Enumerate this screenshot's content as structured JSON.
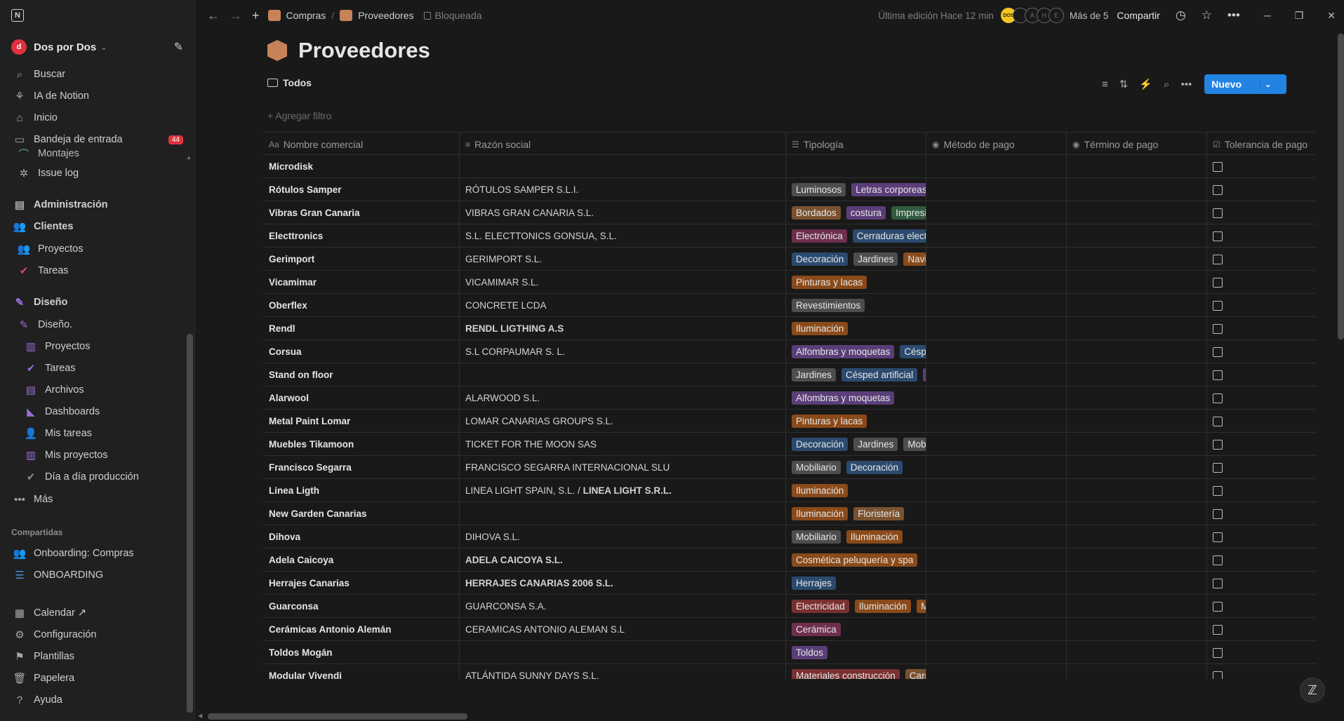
{
  "workspace": {
    "name": "Dos por Dos",
    "avatar_letter": "d"
  },
  "sidebar": {
    "top_items": [
      {
        "name": "sidebar-item-buscar",
        "label": "Buscar",
        "icon": "search-icon",
        "glyph": "⌕"
      },
      {
        "name": "sidebar-item-ia",
        "label": "IA de Notion",
        "icon": "ai-icon",
        "glyph": "⚘"
      },
      {
        "name": "sidebar-item-inicio",
        "label": "Inicio",
        "icon": "home-icon",
        "glyph": "⌂"
      },
      {
        "name": "sidebar-item-bandeja",
        "label": "Bandeja de entrada",
        "icon": "inbox-icon",
        "glyph": "▭",
        "badge": "44"
      }
    ],
    "partial_item": "Montajes",
    "issue_log": "Issue log",
    "administracion": "Administración",
    "clientes": "Clientes",
    "clientes_proyectos": "Proyectos",
    "clientes_tareas": "Tareas",
    "diseno": "Diseño",
    "diseno_sub": "Diseño.",
    "diseno_children": [
      {
        "label": "Proyectos",
        "icon": "database-icon",
        "color": "#9a6dd7"
      },
      {
        "label": "Tareas",
        "icon": "check-circle-icon",
        "color": "#9a6dd7"
      },
      {
        "label": "Archivos",
        "icon": "archive-icon",
        "color": "#9a6dd7"
      },
      {
        "label": "Dashboards",
        "icon": "layers-icon",
        "color": "#9a6dd7"
      },
      {
        "label": "Mis tareas",
        "icon": "person-icon",
        "color": "#9a6dd7"
      },
      {
        "label": "Mis proyectos",
        "icon": "database-icon",
        "color": "#9a6dd7"
      },
      {
        "label": "Día a día producción",
        "icon": "check-circle-icon",
        "color": "#8a8a8a"
      }
    ],
    "mas": "Más",
    "compartidas_heading": "Compartidas",
    "shared": [
      {
        "label": "Onboarding: Compras",
        "icon": "people-icon"
      },
      {
        "label": "ONBOARDING",
        "icon": "list-icon"
      }
    ],
    "bottom": [
      {
        "label": "Calendar ↗",
        "icon": "calendar-icon",
        "glyph": "▦"
      },
      {
        "label": "Configuración",
        "icon": "gear-icon",
        "glyph": "⚙"
      },
      {
        "label": "Plantillas",
        "icon": "template-icon",
        "glyph": "⚑"
      },
      {
        "label": "Papelera",
        "icon": "trash-icon",
        "glyph": "🗑"
      },
      {
        "label": "Ayuda",
        "icon": "help-icon",
        "glyph": "?"
      }
    ]
  },
  "topbar": {
    "breadcrumb_1": "Compras",
    "breadcrumb_2": "Proveedores",
    "locked_label": "Bloqueada",
    "last_edit": "Última edición Hace 12 min",
    "avatars": [
      "DOS",
      "",
      "A",
      "H",
      "E"
    ],
    "more_users": "Más de 5",
    "share": "Compartir"
  },
  "page": {
    "title": "Proveedores",
    "view_name": "Todos",
    "add_filter": "Agregar filtro",
    "new_button": "Nuevo"
  },
  "columns": [
    {
      "label": "Nombre comercial",
      "icon": "Aa"
    },
    {
      "label": "Razón social",
      "icon": "≡"
    },
    {
      "label": "Tipología",
      "icon": "☰"
    },
    {
      "label": "Método de pago",
      "icon": "◉"
    },
    {
      "label": "Término de pago",
      "icon": "◉"
    },
    {
      "label": "Tolerancia de pago",
      "icon": "☑"
    }
  ],
  "tag_colors": {
    "gray": "#4d4d4d",
    "purple": "#5a3e78",
    "brown": "#7a5230",
    "orange": "#8a4a1a",
    "red": "#7a3030",
    "blue": "#2b4a6e",
    "green": "#2f5a3d",
    "pink": "#6e2f4e"
  },
  "rows": [
    {
      "name": "Microdisk",
      "razon": "",
      "razon_bold": false,
      "tags": []
    },
    {
      "name": "Rótulos Samper",
      "razon": "RÓTULOS SAMPER S.L.I.",
      "razon_bold": false,
      "tags": [
        {
          "t": "Luminosos",
          "c": "gray"
        },
        {
          "t": "Letras corporeas",
          "c": "purple"
        }
      ]
    },
    {
      "name": "Vibras Gran Canaria",
      "razon": "VIBRAS GRAN CANARIA S.L.",
      "razon_bold": false,
      "tags": [
        {
          "t": "Bordados",
          "c": "brown"
        },
        {
          "t": "costura",
          "c": "purple"
        },
        {
          "t": "Impresión",
          "c": "green"
        }
      ]
    },
    {
      "name": "Electtronics",
      "razon": "S.L. ELECTTONICS GONSUA, S.L.",
      "razon_bold": false,
      "tags": [
        {
          "t": "Electrónica",
          "c": "pink"
        },
        {
          "t": "Cerraduras electrónicas",
          "c": "blue"
        }
      ]
    },
    {
      "name": "Gerimport",
      "razon": "GERIMPORT S.L.",
      "razon_bold": false,
      "tags": [
        {
          "t": "Decoración",
          "c": "blue"
        },
        {
          "t": "Jardines",
          "c": "gray"
        },
        {
          "t": "Navidad",
          "c": "orange"
        }
      ]
    },
    {
      "name": "Vicamimar",
      "razon": "VICAMIMAR S.L.",
      "razon_bold": false,
      "tags": [
        {
          "t": "Pinturas y lacas",
          "c": "orange"
        }
      ]
    },
    {
      "name": "Oberflex",
      "razon": "CONCRETE LCDA",
      "razon_bold": false,
      "tags": [
        {
          "t": "Revestimientos",
          "c": "gray"
        }
      ]
    },
    {
      "name": "Rendl",
      "razon": "RENDL LIGTHING A.S",
      "razon_bold": true,
      "tags": [
        {
          "t": "Iluminación",
          "c": "orange"
        }
      ]
    },
    {
      "name": "Corsua",
      "razon": "S.L CORPAUMAR S. L.",
      "razon_bold": false,
      "tags": [
        {
          "t": "Alfombras y moquetas",
          "c": "purple"
        },
        {
          "t": "Césped artificial",
          "c": "blue"
        }
      ]
    },
    {
      "name": "Stand on floor",
      "razon": "",
      "razon_bold": false,
      "tags": [
        {
          "t": "Jardines",
          "c": "gray"
        },
        {
          "t": "Césped artificial",
          "c": "blue"
        },
        {
          "t": "Alfombras",
          "c": "purple"
        }
      ]
    },
    {
      "name": "Alarwool",
      "razon": "ALARWOOD S.L.",
      "razon_bold": false,
      "tags": [
        {
          "t": "Alfombras y moquetas",
          "c": "purple"
        }
      ]
    },
    {
      "name": "Metal Paint Lomar",
      "razon": "LOMAR CANARIAS GROUPS S.L.",
      "razon_bold": false,
      "tags": [
        {
          "t": "Pinturas y lacas",
          "c": "orange"
        }
      ]
    },
    {
      "name": "Muebles Tikamoon",
      "razon": "TICKET FOR THE MOON SAS",
      "razon_bold": false,
      "tags": [
        {
          "t": "Decoración",
          "c": "blue"
        },
        {
          "t": "Jardines",
          "c": "gray"
        },
        {
          "t": "Mobiliario",
          "c": "gray"
        }
      ]
    },
    {
      "name": "Francisco Segarra",
      "razon": "FRANCISCO SEGARRA INTERNACIONAL SLU",
      "razon_bold": false,
      "tags": [
        {
          "t": "Mobiliario",
          "c": "gray"
        },
        {
          "t": "Decoración",
          "c": "blue"
        }
      ]
    },
    {
      "name": "Linea Ligth",
      "razon": "LINEA LIGHT SPAIN, S.L. / ",
      "razon_extra_bold": "LINEA LIGHT S.R.L.",
      "razon_bold": false,
      "tags": [
        {
          "t": "Iluminación",
          "c": "orange"
        }
      ]
    },
    {
      "name": "New Garden Canarias",
      "razon": "",
      "razon_bold": false,
      "tags": [
        {
          "t": "Iluminación",
          "c": "orange"
        },
        {
          "t": "Floristería",
          "c": "brown"
        }
      ]
    },
    {
      "name": "Dihova",
      "razon": "DIHOVA S.L.",
      "razon_bold": false,
      "tags": [
        {
          "t": "Mobiliario",
          "c": "gray"
        },
        {
          "t": "Iluminación",
          "c": "orange"
        }
      ]
    },
    {
      "name": "Adela Caicoya",
      "razon": "ADELA CAICOYA S.L.",
      "razon_bold": true,
      "tags": [
        {
          "t": "Cosmética peluquería y spa",
          "c": "orange"
        }
      ]
    },
    {
      "name": "Herrajes Canarias",
      "razon": "HERRAJES CANARIAS 2006 S.L.",
      "razon_bold": true,
      "tags": [
        {
          "t": "Herrajes",
          "c": "blue"
        }
      ]
    },
    {
      "name": "Guarconsa",
      "razon": "GUARCONSA S.A.",
      "razon_bold": false,
      "tags": [
        {
          "t": "Electricidad",
          "c": "red"
        },
        {
          "t": "Iluminación",
          "c": "orange"
        },
        {
          "t": "Material",
          "c": "orange"
        }
      ]
    },
    {
      "name": "Cerámicas Antonio Alemán",
      "razon": "CERAMICAS ANTONIO ALEMAN S.L",
      "razon_bold": false,
      "tags": [
        {
          "t": "Cerámica",
          "c": "pink"
        }
      ]
    },
    {
      "name": "Toldos Mogán",
      "razon": "",
      "razon_bold": false,
      "tags": [
        {
          "t": "Toldos",
          "c": "purple"
        }
      ]
    },
    {
      "name": "Modular Vivendi",
      "razon": "ATLÁNTIDA SUNNY DAYS S.L.",
      "razon_bold": false,
      "tags": [
        {
          "t": "Materiales construcción",
          "c": "red"
        },
        {
          "t": "Carpintería",
          "c": "brown"
        }
      ]
    }
  ]
}
